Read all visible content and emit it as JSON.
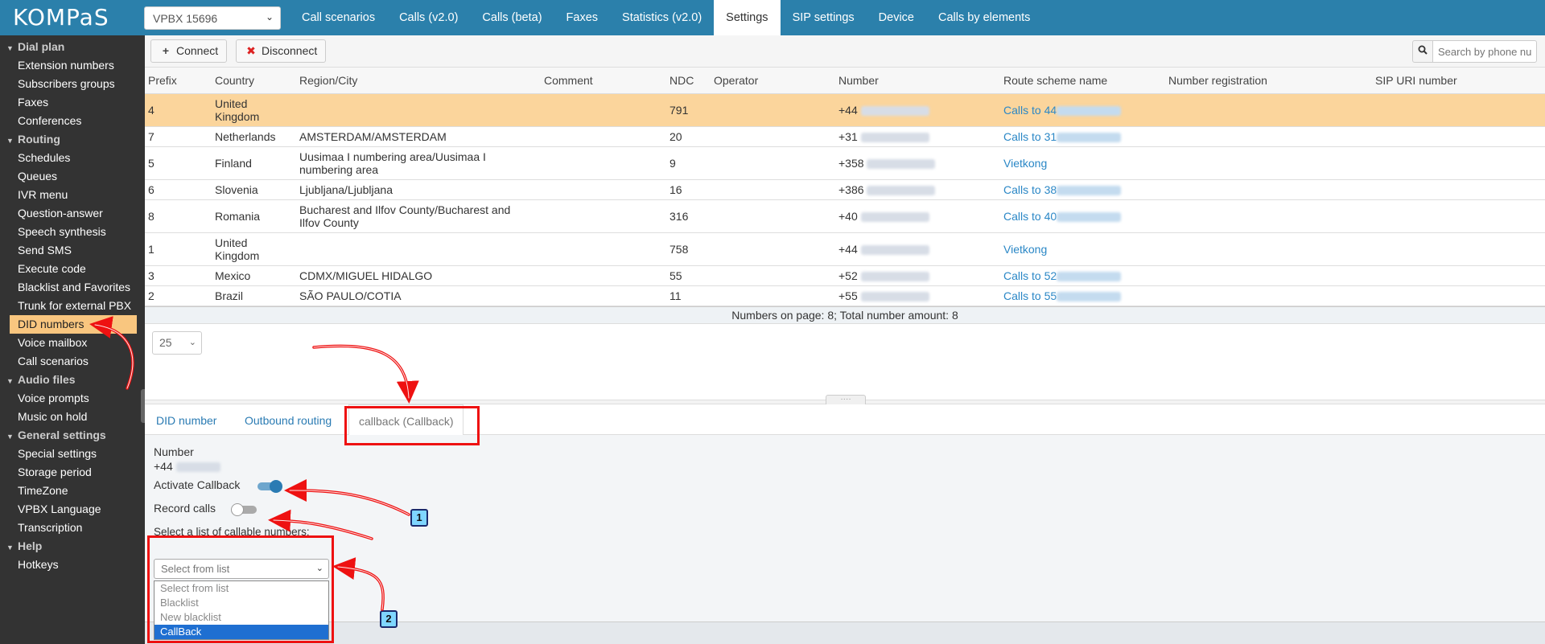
{
  "brand": {
    "logo_text": "KOMPaS"
  },
  "header": {
    "vpbx_select": "VPBX 15696",
    "tabs": [
      {
        "label": "Call scenarios"
      },
      {
        "label": "Calls (v2.0)"
      },
      {
        "label": "Calls (beta)"
      },
      {
        "label": "Faxes"
      },
      {
        "label": "Statistics (v2.0)"
      },
      {
        "label": "Settings"
      },
      {
        "label": "SIP settings"
      },
      {
        "label": "Device"
      },
      {
        "label": "Calls by elements"
      }
    ],
    "active_tab": "Settings"
  },
  "sidebar": {
    "sections": [
      {
        "title": "Dial plan",
        "items": [
          "Extension numbers",
          "Subscribers groups",
          "Faxes",
          "Conferences"
        ]
      },
      {
        "title": "Routing",
        "items": [
          "Schedules",
          "Queues",
          "IVR menu",
          "Question-answer",
          "Speech synthesis",
          "Send SMS",
          "Execute code",
          "Blacklist and Favorites",
          "Trunk for external PBX",
          "DID numbers",
          "Voice mailbox",
          "Call scenarios"
        ]
      },
      {
        "title": "Audio files",
        "items": [
          "Voice prompts",
          "Music on hold"
        ]
      },
      {
        "title": "General settings",
        "items": [
          "Special settings",
          "Storage period",
          "TimeZone",
          "VPBX Language",
          "Transcription"
        ]
      },
      {
        "title": "Help",
        "items": [
          "Hotkeys"
        ]
      }
    ],
    "active_item": "DID numbers"
  },
  "toolbar": {
    "connect_label": "Connect",
    "disconnect_label": "Disconnect",
    "search_placeholder": "Search by phone num"
  },
  "table": {
    "columns": [
      "Prefix",
      "Country",
      "Region/City",
      "Comment",
      "NDC",
      "Operator",
      "Number",
      "Route scheme name",
      "Number registration",
      "SIP URI number"
    ],
    "rows": [
      {
        "prefix": "4",
        "country": "United Kingdom",
        "region": "",
        "ndc": "791",
        "number": "+44",
        "route": "Calls to 44",
        "selected": true
      },
      {
        "prefix": "7",
        "country": "Netherlands",
        "region": "AMSTERDAM/AMSTERDAM",
        "ndc": "20",
        "number": "+31",
        "route": "Calls to 31"
      },
      {
        "prefix": "5",
        "country": "Finland",
        "region": "Uusimaa I numbering area/Uusimaa I numbering area",
        "ndc": "9",
        "number": "+358",
        "route": "Vietkong"
      },
      {
        "prefix": "6",
        "country": "Slovenia",
        "region": "Ljubljana/Ljubljana",
        "ndc": "16",
        "number": "+386",
        "route": "Calls to 38"
      },
      {
        "prefix": "8",
        "country": "Romania",
        "region": "Bucharest and Ilfov County/Bucharest and Ilfov County",
        "ndc": "316",
        "number": "+40",
        "route": "Calls to 40"
      },
      {
        "prefix": "1",
        "country": "United Kingdom",
        "region": "",
        "ndc": "758",
        "number": "+44",
        "route": "Vietkong"
      },
      {
        "prefix": "3",
        "country": "Mexico",
        "region": "CDMX/MIGUEL HIDALGO",
        "ndc": "55",
        "number": "+52",
        "route": "Calls to 52"
      },
      {
        "prefix": "2",
        "country": "Brazil",
        "region": "SÃO PAULO/COTIA",
        "ndc": "11",
        "number": "+55",
        "route": "Calls to 55"
      }
    ],
    "footer": "Numbers on page: 8; Total number amount: 8"
  },
  "pager": {
    "page_size": "25"
  },
  "details": {
    "tabs": [
      "DID number",
      "Outbound routing",
      "callback (Callback)"
    ],
    "active_tab": "callback (Callback)",
    "number_label": "Number",
    "number_value": "+44",
    "activate_callback_label": "Activate Callback",
    "activate_callback_on": true,
    "record_calls_label": "Record calls",
    "record_calls_on": false,
    "callable_list_label": "Select a list of callable numbers:",
    "callable_list_value": "Select from list",
    "callable_options": [
      "Select from list",
      "Blacklist",
      "New blacklist",
      "CallBack"
    ],
    "highlighted_option": "CallBack"
  },
  "annotations": {
    "badge_1": "1",
    "badge_2": "2"
  },
  "colors": {
    "header_bg": "#2b80ab",
    "sidebar_bg": "#333333",
    "selected_row": "#fbd59c",
    "accent_link": "#2a87c6",
    "annotation_red": "#e11111"
  }
}
